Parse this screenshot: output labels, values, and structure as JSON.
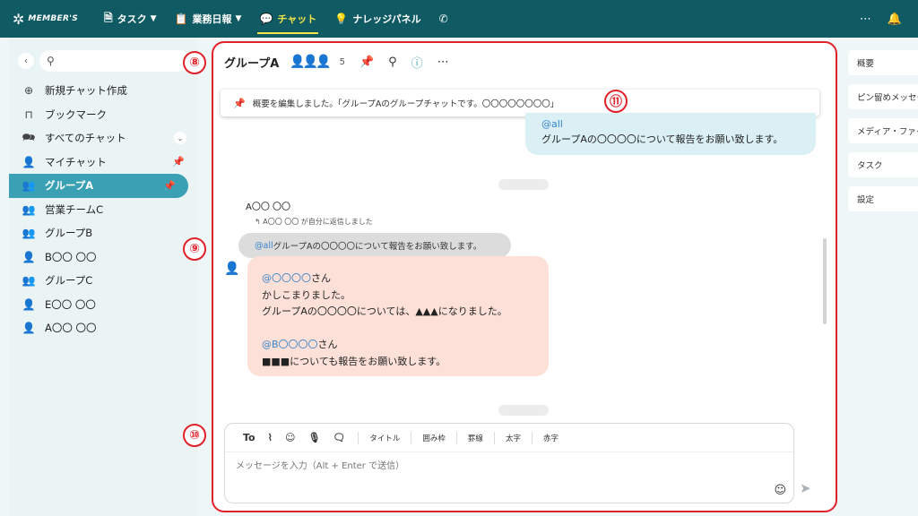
{
  "topbar": {
    "logo_text": "MEMBER'S",
    "nav": [
      {
        "label": "タスク",
        "icon": "document-icon",
        "chevron": true
      },
      {
        "label": "業務日報",
        "icon": "clipboard-icon",
        "chevron": true
      },
      {
        "label": "チャット",
        "icon": "chat-icon",
        "chevron": false,
        "active": true
      },
      {
        "label": "ナレッジパネル",
        "icon": "lightbulb-icon",
        "chevron": false
      },
      {
        "label": "",
        "icon": "phone-icon",
        "chevron": false
      }
    ]
  },
  "sidebar": {
    "search_placeholder": "",
    "items": [
      {
        "label": "新規チャット作成",
        "icon": "plus-circle-icon"
      },
      {
        "label": "ブックマーク",
        "icon": "bookmark-icon"
      },
      {
        "label": "すべてのチャット",
        "icon": "chat-icon",
        "expand": true
      },
      {
        "label": "マイチャット",
        "icon": "person-icon",
        "pinned": true
      },
      {
        "label": "グループA",
        "icon": "group-icon",
        "pinned": true,
        "active": true
      },
      {
        "label": "営業チームC",
        "icon": "group-icon"
      },
      {
        "label": "グループB",
        "icon": "group-icon"
      },
      {
        "label": "B〇〇 〇〇",
        "icon": "person-icon"
      },
      {
        "label": "グループC",
        "icon": "group-icon"
      },
      {
        "label": "E〇〇 〇〇",
        "icon": "person-icon"
      },
      {
        "label": "A〇〇 〇〇",
        "icon": "person-icon"
      }
    ]
  },
  "chat": {
    "title": "グループA",
    "member_count": "5",
    "pinned_notice": "概要を編集しました。「グループAのグループチャットです。〇〇〇〇〇〇〇〇」",
    "my_message": {
      "mention": "@all",
      "text": "グループAの〇〇〇〇について報告をお願い致します。"
    },
    "reply": {
      "sender": "A〇〇 〇〇",
      "reply_note": "A〇〇 〇〇 が自分に返信しました",
      "quote_mention": "@all",
      "quote_text": "グループAの〇〇〇〇について報告をお願い致します。",
      "lines": [
        {
          "mention": "@〇〇〇〇",
          "text": "さん"
        },
        {
          "mention": "",
          "text": "かしこまりました。"
        },
        {
          "mention": "",
          "text": "グループAの〇〇〇〇については、▲▲▲になりました。"
        },
        {
          "mention": "",
          "text": ""
        },
        {
          "mention": "@B〇〇〇〇",
          "text": "さん"
        },
        {
          "mention": "",
          "text": "■■■についても報告をお願い致します。"
        }
      ]
    }
  },
  "composer": {
    "to_label": "To",
    "format_buttons": [
      "タイトル",
      "囲み枠",
      "罫線",
      "太字",
      "赤字"
    ],
    "placeholder": "メッセージを入力（Alt + Enter で送信）"
  },
  "right_panel": {
    "tabs": [
      "概要",
      "ピン留めメッセージ",
      "メディア・ファイル",
      "タスク",
      "設定"
    ]
  },
  "callouts": {
    "c8": "⑧",
    "c9": "⑨",
    "c10": "⑩",
    "c11": "⑪"
  },
  "colors": {
    "topbar": "#0f5a63",
    "accent": "#3aa0b4",
    "active_nav": "#f7e64a",
    "callout_red": "#e0202a",
    "my_bubble": "#daf0f5",
    "recv_bubble": "#fde1d8",
    "mention": "#3a83c9"
  }
}
